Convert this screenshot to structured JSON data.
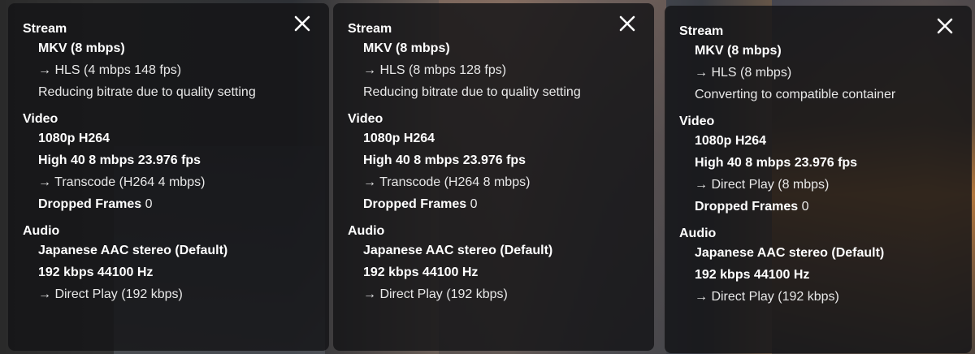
{
  "panels": [
    {
      "close_icon": "close-icon",
      "stream": {
        "title": "Stream",
        "format": "MKV (8 mbps)",
        "target": "→ HLS (4 mbps 148 fps)",
        "reason": "Reducing bitrate due to quality setting"
      },
      "video": {
        "title": "Video",
        "resolution": "1080p H264",
        "profile": "High 40 8 mbps 23.976 fps",
        "mode": "→ Transcode (H264 4 mbps)",
        "dropped_label": "Dropped Frames",
        "dropped_value": "0"
      },
      "audio": {
        "title": "Audio",
        "track": "Japanese AAC stereo (Default)",
        "rate": "192 kbps 44100 Hz",
        "mode": "→ Direct Play (192 kbps)"
      }
    },
    {
      "close_icon": "close-icon",
      "stream": {
        "title": "Stream",
        "format": "MKV (8 mbps)",
        "target": "→ HLS (8 mbps 128 fps)",
        "reason": "Reducing bitrate due to quality setting"
      },
      "video": {
        "title": "Video",
        "resolution": "1080p H264",
        "profile": "High 40 8 mbps 23.976 fps",
        "mode": "→ Transcode (H264 8 mbps)",
        "dropped_label": "Dropped Frames",
        "dropped_value": "0"
      },
      "audio": {
        "title": "Audio",
        "track": "Japanese AAC stereo (Default)",
        "rate": "192 kbps 44100 Hz",
        "mode": "→ Direct Play (192 kbps)"
      }
    },
    {
      "close_icon": "close-icon",
      "stream": {
        "title": "Stream",
        "format": "MKV (8 mbps)",
        "target": "→ HLS (8 mbps)",
        "reason": "Converting to compatible container"
      },
      "video": {
        "title": "Video",
        "resolution": "1080p H264",
        "profile": "High 40 8 mbps 23.976 fps",
        "mode": "→ Direct Play (8 mbps)",
        "dropped_label": "Dropped Frames",
        "dropped_value": "0"
      },
      "audio": {
        "title": "Audio",
        "track": "Japanese AAC stereo (Default)",
        "rate": "192 kbps 44100 Hz",
        "mode": "→ Direct Play (192 kbps)"
      }
    }
  ],
  "colors": {
    "panel_bg": "#141416",
    "text": "#ffffff"
  }
}
